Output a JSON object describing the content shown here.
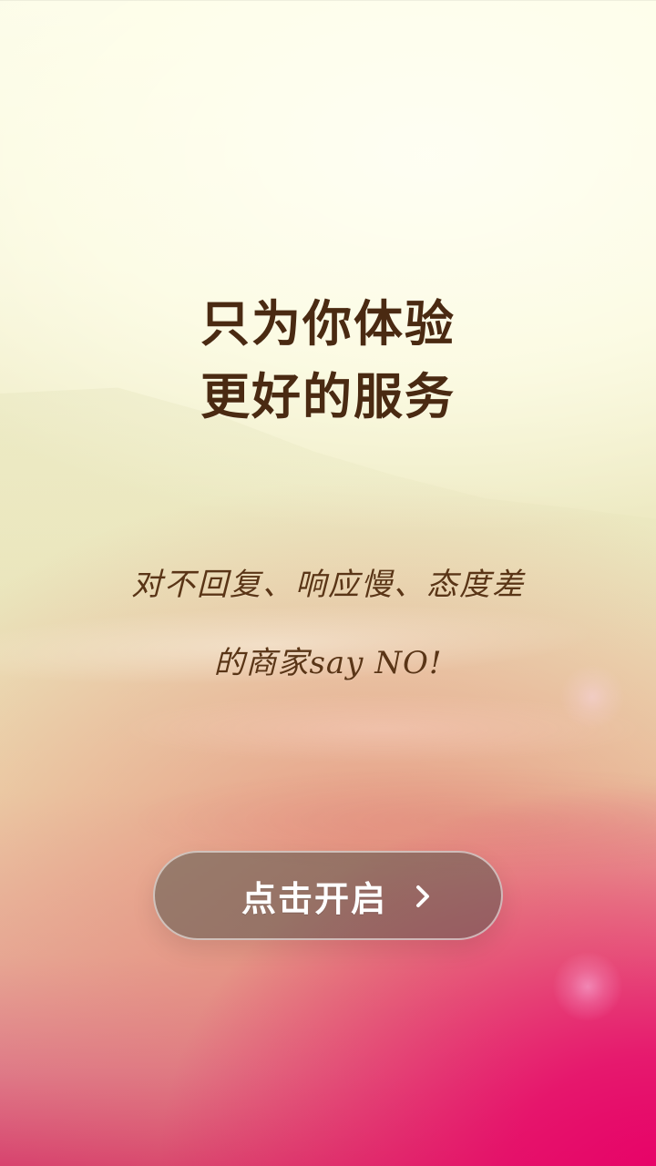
{
  "headline": {
    "line1": "只为你体验",
    "line2": "更好的服务"
  },
  "subtext": {
    "line1": "对不回复、响应慢、态度差",
    "line2": "的商家say NO!"
  },
  "cta": {
    "label": "点击开启",
    "icon": "chevron-right-icon"
  },
  "colors": {
    "headline": "#4a2a12",
    "subtext": "#5a3516",
    "button_fill": "rgba(88,88,78,0.55)",
    "button_text": "#ffffff",
    "accent_pink": "#e80068"
  }
}
